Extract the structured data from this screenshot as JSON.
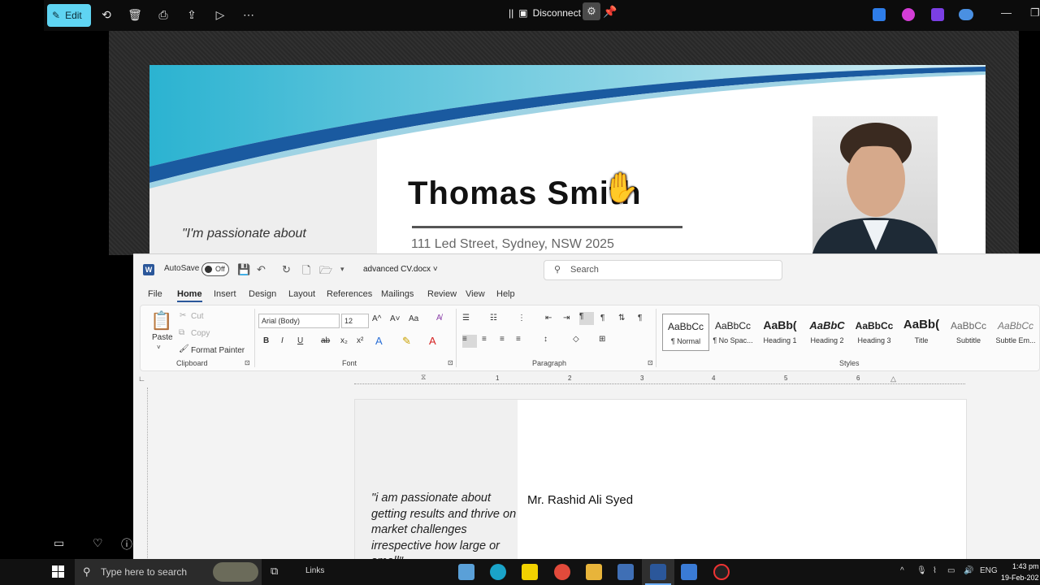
{
  "viewer": {
    "edit_label": "Edit",
    "disconnect_label": "Disconnect",
    "separator": "||"
  },
  "cv_preview": {
    "quote": "\"I'm passionate about",
    "name": "Thomas Smith",
    "address": "111 Led Street, Sydney, NSW 2025"
  },
  "word": {
    "autosave_label": "AutoSave",
    "autosave_state": "Off",
    "doc_name": "advanced CV.docx",
    "search_placeholder": "Search",
    "menu": [
      "File",
      "Home",
      "Insert",
      "Design",
      "Layout",
      "References",
      "Mailings",
      "Review",
      "View",
      "Help"
    ],
    "clipboard": {
      "paste": "Paste",
      "cut": "Cut",
      "copy": "Copy",
      "format_painter": "Format Painter",
      "label": "Clipboard"
    },
    "font": {
      "family": "Arial (Body)",
      "size": "12",
      "label": "Font",
      "grow": "A^",
      "shrink": "A˅",
      "case": "Aa",
      "bold": "B",
      "italic": "I",
      "underline": "U",
      "strike": "ab",
      "sub": "x₂",
      "sup": "x²"
    },
    "paragraph": {
      "label": "Paragraph"
    },
    "styles": {
      "label": "Styles",
      "items": [
        {
          "sample": "AaBbCc",
          "name": "¶ Normal"
        },
        {
          "sample": "AaBbCc",
          "name": "¶ No Spac..."
        },
        {
          "sample": "AaBb(",
          "name": "Heading 1"
        },
        {
          "sample": "AaBbC",
          "name": "Heading 2"
        },
        {
          "sample": "AaBbCc",
          "name": "Heading 3"
        },
        {
          "sample": "AaBb(",
          "name": "Title"
        },
        {
          "sample": "AaBbCc",
          "name": "Subtitle"
        },
        {
          "sample": "AaBbCc",
          "name": "Subtle Em..."
        }
      ]
    },
    "ruler_numbers": [
      "1",
      "2",
      "3",
      "4",
      "5",
      "6"
    ],
    "page": {
      "quote": "\"i am passionate about getting results and thrive on market challenges irrespective how large or small\"",
      "name": "Mr. Rashid Ali Syed"
    }
  },
  "taskbar": {
    "search_placeholder": "Type here to search",
    "links_label": "Links",
    "lang": "ENG",
    "time": "1:43 pm",
    "date": "19-Feb-202"
  },
  "colors": {
    "edit_accent": "#5fd4f2",
    "word_blue": "#2b579a",
    "cv_teal": "#2bb3d1"
  }
}
